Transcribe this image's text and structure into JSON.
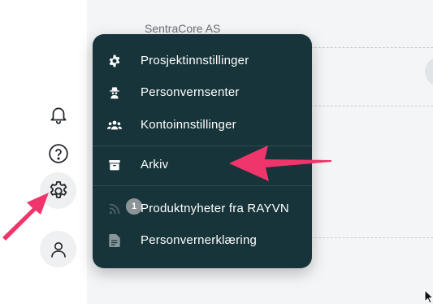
{
  "organization": {
    "name": "SentraCore AS"
  },
  "rail": {
    "icons": [
      "bell-icon",
      "help-icon",
      "gear-icon",
      "user-icon"
    ]
  },
  "menu": {
    "items": [
      {
        "label": "Prosjektinnstillinger",
        "icon": "gear-icon"
      },
      {
        "label": "Personvernsenter",
        "icon": "spy-icon"
      },
      {
        "label": "Kontoinnstillinger",
        "icon": "users-icon"
      },
      {
        "label": "Arkiv",
        "icon": "archive-icon"
      },
      {
        "label": "Produktnyheter fra RAYVN",
        "icon": "feed-icon",
        "badge": "1"
      },
      {
        "label": "Personvernerklæring",
        "icon": "document-icon"
      }
    ]
  },
  "colors": {
    "menu_bg": "#17343a",
    "annotation_arrow": "#f0356b"
  }
}
